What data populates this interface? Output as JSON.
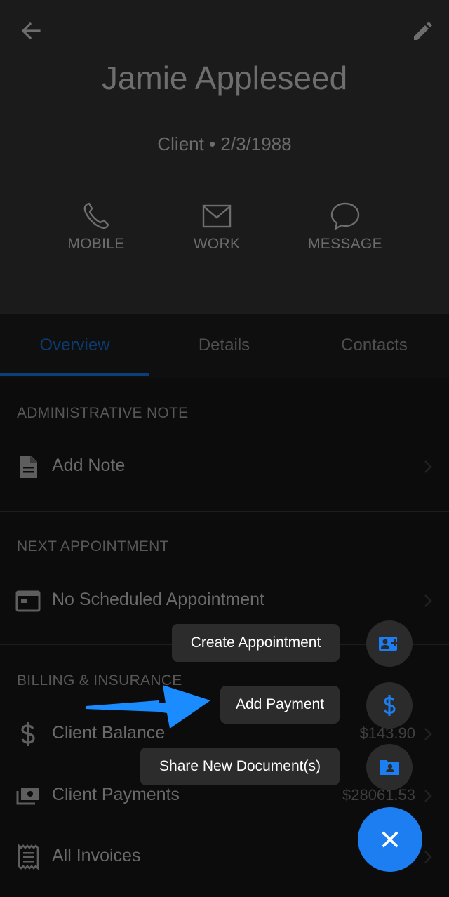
{
  "header": {
    "name": "Jamie Appleseed",
    "subtitle": "Client • 2/3/1988",
    "actions": [
      {
        "label": "MOBILE",
        "icon": "phone-icon"
      },
      {
        "label": "WORK",
        "icon": "mail-icon"
      },
      {
        "label": "MESSAGE",
        "icon": "chat-bubble-icon"
      }
    ]
  },
  "tabs": [
    {
      "label": "Overview",
      "active": true
    },
    {
      "label": "Details",
      "active": false
    },
    {
      "label": "Contacts",
      "active": false
    }
  ],
  "sections": {
    "admin_note": {
      "title": "ADMINISTRATIVE NOTE",
      "rows": [
        {
          "label": "Add Note",
          "icon": "document-icon"
        }
      ]
    },
    "next_appointment": {
      "title": "NEXT APPOINTMENT",
      "rows": [
        {
          "label": "No Scheduled Appointment",
          "icon": "calendar-icon"
        }
      ]
    },
    "billing": {
      "title": "BILLING & INSURANCE",
      "rows": [
        {
          "label": "Client Balance",
          "amount": "$143.90",
          "icon": "dollar-icon"
        },
        {
          "label": "Client Payments",
          "amount": "$28061.53",
          "icon": "payments-icon"
        },
        {
          "label": "All Invoices",
          "icon": "receipt-icon"
        }
      ]
    }
  },
  "fab_menu": {
    "items": [
      {
        "label": "Create Appointment",
        "icon": "contact-add-icon"
      },
      {
        "label": "Add Payment",
        "icon": "dollar-icon"
      },
      {
        "label": "Share New Document(s)",
        "icon": "shared-folder-icon"
      }
    ],
    "close_icon": "close-icon"
  },
  "colors": {
    "accent": "#1c7ef0",
    "fab_label_bg": "#2c2c2c",
    "pointer_arrow": "#1a8cff"
  }
}
